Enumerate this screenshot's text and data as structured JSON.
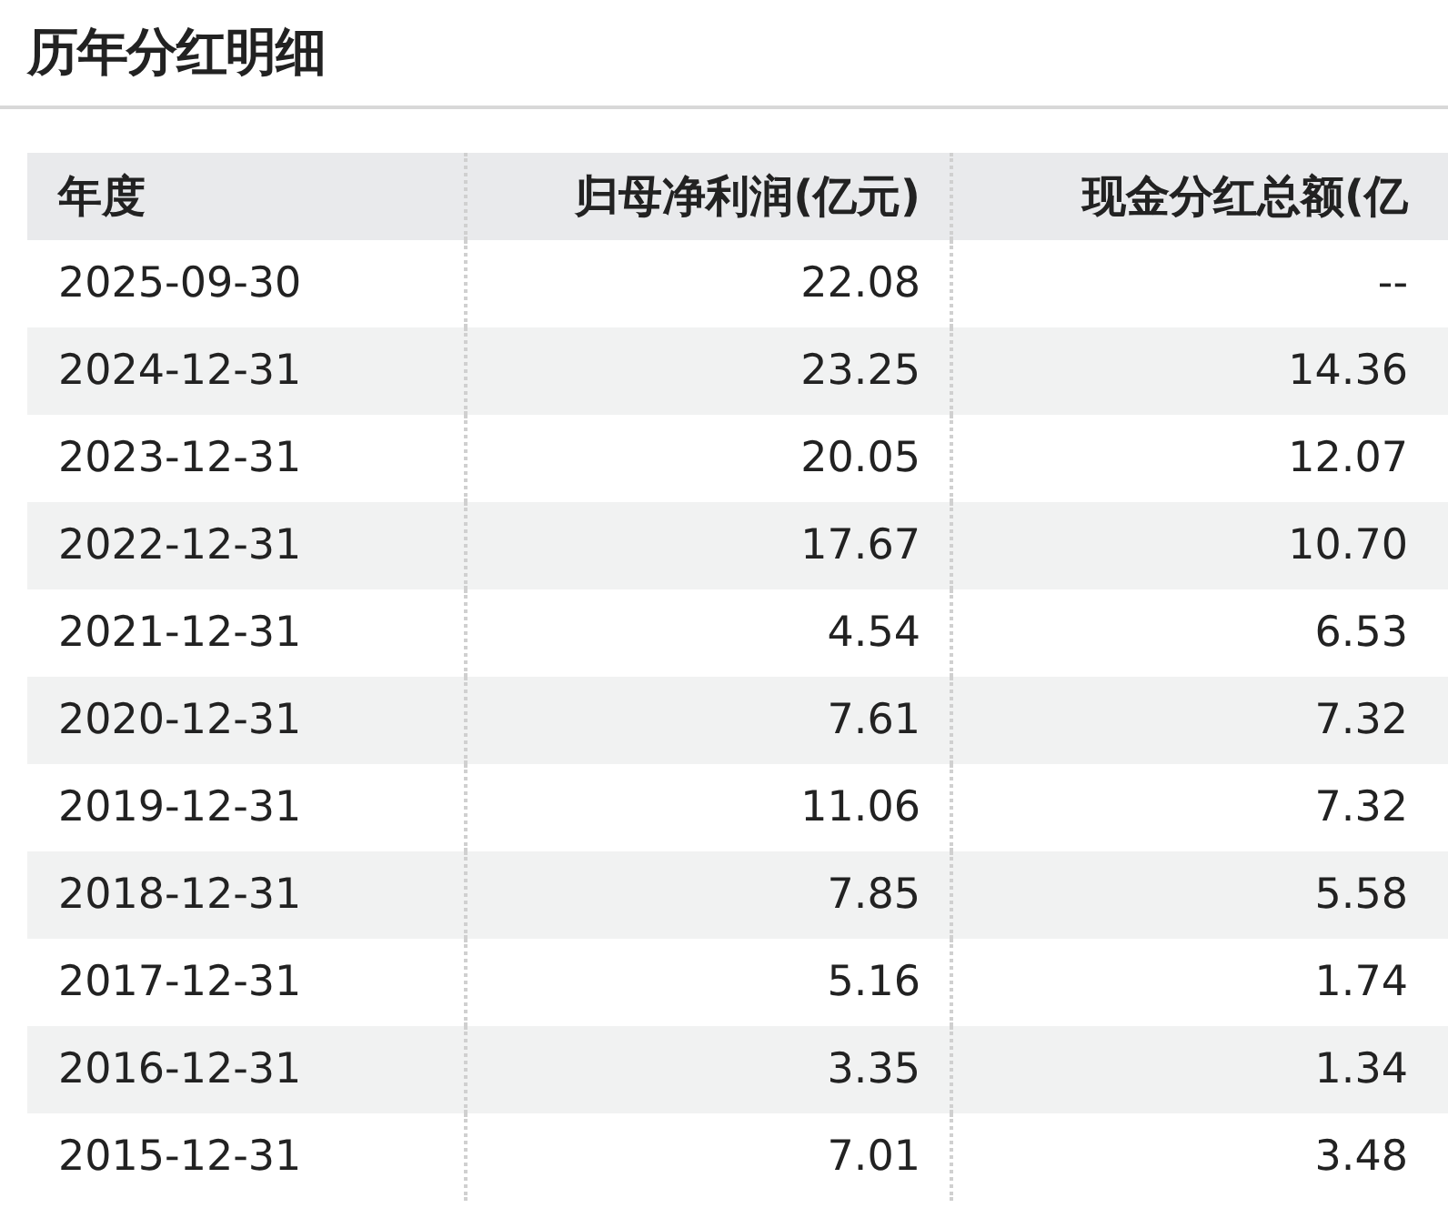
{
  "title": "历年分红明细",
  "table": {
    "columns": [
      "年度",
      "归母净利润(亿元)",
      "现金分红总额(亿"
    ],
    "rows": [
      [
        "2025-09-30",
        "22.08",
        "--"
      ],
      [
        "2024-12-31",
        "23.25",
        "14.36"
      ],
      [
        "2023-12-31",
        "20.05",
        "12.07"
      ],
      [
        "2022-12-31",
        "17.67",
        "10.70"
      ],
      [
        "2021-12-31",
        "4.54",
        "6.53"
      ],
      [
        "2020-12-31",
        "7.61",
        "7.32"
      ],
      [
        "2019-12-31",
        "11.06",
        "7.32"
      ],
      [
        "2018-12-31",
        "7.85",
        "5.58"
      ],
      [
        "2017-12-31",
        "5.16",
        "1.74"
      ],
      [
        "2016-12-31",
        "3.35",
        "1.34"
      ],
      [
        "2015-12-31",
        "7.01",
        "3.48"
      ]
    ]
  }
}
